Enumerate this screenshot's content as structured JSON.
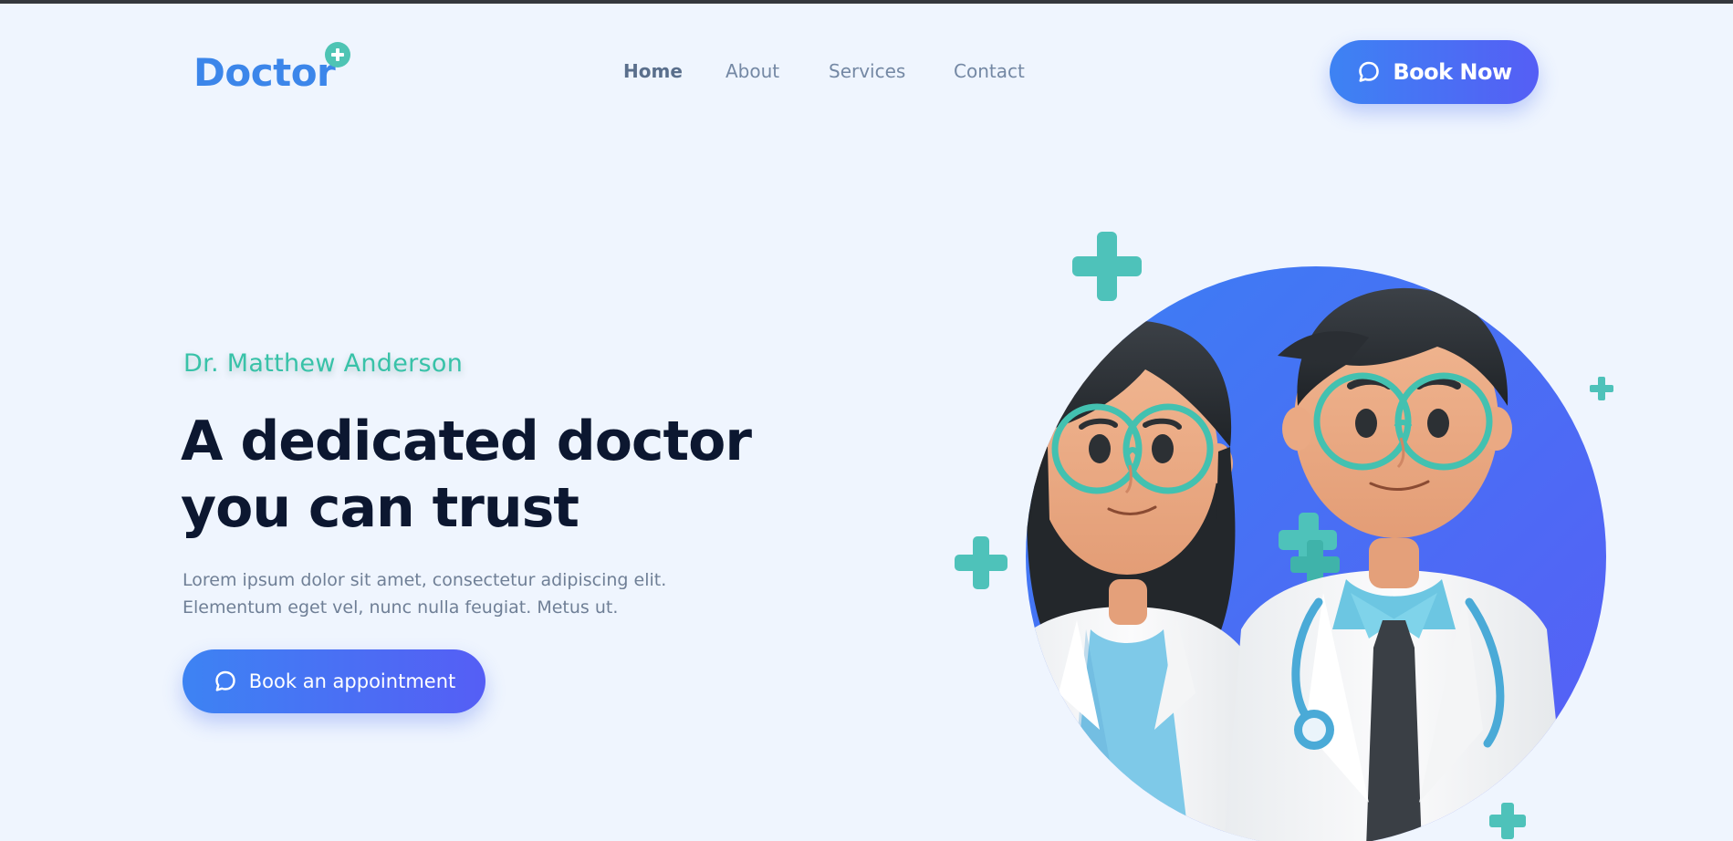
{
  "header": {
    "logo_text": "Doctor",
    "nav": [
      {
        "label": "Home",
        "active": true
      },
      {
        "label": "About",
        "active": false
      },
      {
        "label": "Services",
        "active": false
      },
      {
        "label": "Contact",
        "active": false
      }
    ],
    "cta_label": "Book Now",
    "cta_icon": "chat-bubble-icon"
  },
  "hero": {
    "name": "Dr. Matthew Anderson",
    "headline_line1": "A dedicated doctor",
    "headline_line2": "you can trust",
    "description_line1": "Lorem ipsum dolor sit amet, consectetur adipiscing elit.",
    "description_line2": "Elementum eget vel, nunc nulla feugiat. Metus ut.",
    "button_label": "Book an appointment",
    "button_icon": "chat-bubble-icon",
    "illustration": "two-doctors-illustration"
  },
  "colors": {
    "background": "#eff5fe",
    "brand_blue": "#3c86ea",
    "accent_teal": "#4ec4b4",
    "heading": "#0c1730",
    "button_gradient_start": "#3d83f3",
    "button_gradient_end": "#555ef5"
  }
}
